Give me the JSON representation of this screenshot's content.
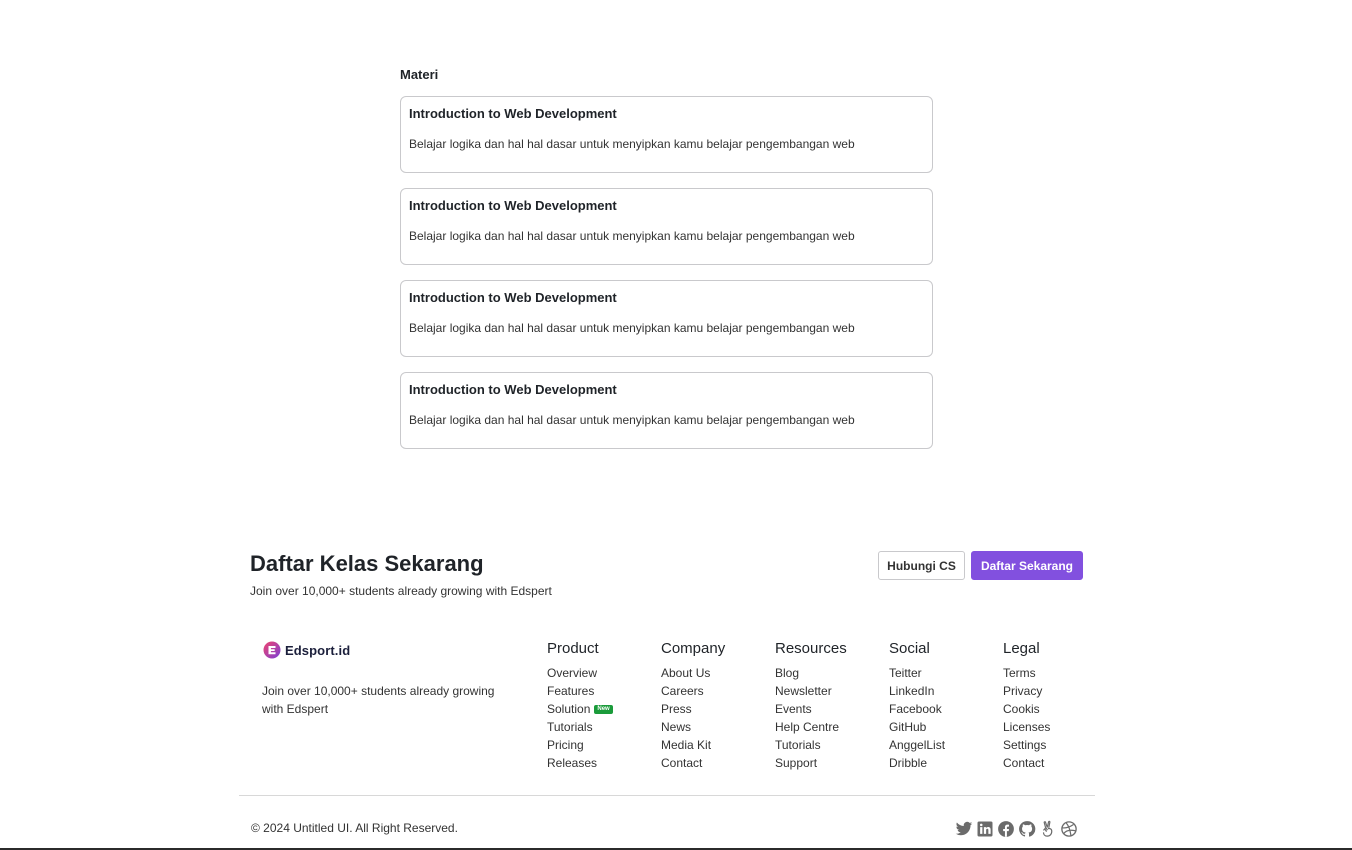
{
  "materi": {
    "title": "Materi",
    "items": [
      {
        "title": "Introduction to Web Development",
        "description": "Belajar logika dan hal hal dasar untuk menyipkan kamu belajar pengembangan web"
      },
      {
        "title": "Introduction to Web Development",
        "description": "Belajar logika dan hal hal dasar untuk menyipkan kamu belajar pengembangan web"
      },
      {
        "title": "Introduction to Web Development",
        "description": "Belajar logika dan hal hal dasar untuk menyipkan kamu belajar pengembangan web"
      },
      {
        "title": "Introduction to Web Development",
        "description": "Belajar logika dan hal hal dasar untuk menyipkan kamu belajar pengembangan web"
      }
    ]
  },
  "cta": {
    "title": "Daftar Kelas Sekarang",
    "subtitle": "Join over 10,000+ students already growing with Edspert",
    "secondary_button": "Hubungi CS",
    "primary_button": "Daftar Sekarang"
  },
  "footer": {
    "brand_name": "Edsport.id",
    "brand_description": "Join over 10,000+ students already growing with Edspert",
    "columns": [
      {
        "title": "Product",
        "links": [
          "Overview",
          "Features",
          "Solution",
          "Tutorials",
          "Pricing",
          "Releases"
        ],
        "badge": "New"
      },
      {
        "title": "Company",
        "links": [
          "About Us",
          "Careers",
          "Press",
          "News",
          "Media Kit",
          "Contact"
        ]
      },
      {
        "title": "Resources",
        "links": [
          "Blog",
          "Newsletter",
          "Events",
          "Help Centre",
          "Tutorials",
          "Support"
        ]
      },
      {
        "title": "Social",
        "links": [
          "Teitter",
          "LinkedIn",
          "Facebook",
          "GitHub",
          "AnggelList",
          "Dribble"
        ]
      },
      {
        "title": "Legal",
        "links": [
          "Terms",
          "Privacy",
          "Cookis",
          "Licenses",
          "Settings",
          "Contact"
        ]
      }
    ],
    "copyright": "© 2024 Untitled UI. All Right Reserved.",
    "social_icons": [
      "twitter-icon",
      "linkedin-icon",
      "facebook-icon",
      "github-icon",
      "angellist-icon",
      "dribbble-icon"
    ]
  },
  "colors": {
    "primary": "#8250df",
    "badge": "#1a9b3a",
    "brand_logo": "#e6396b"
  }
}
